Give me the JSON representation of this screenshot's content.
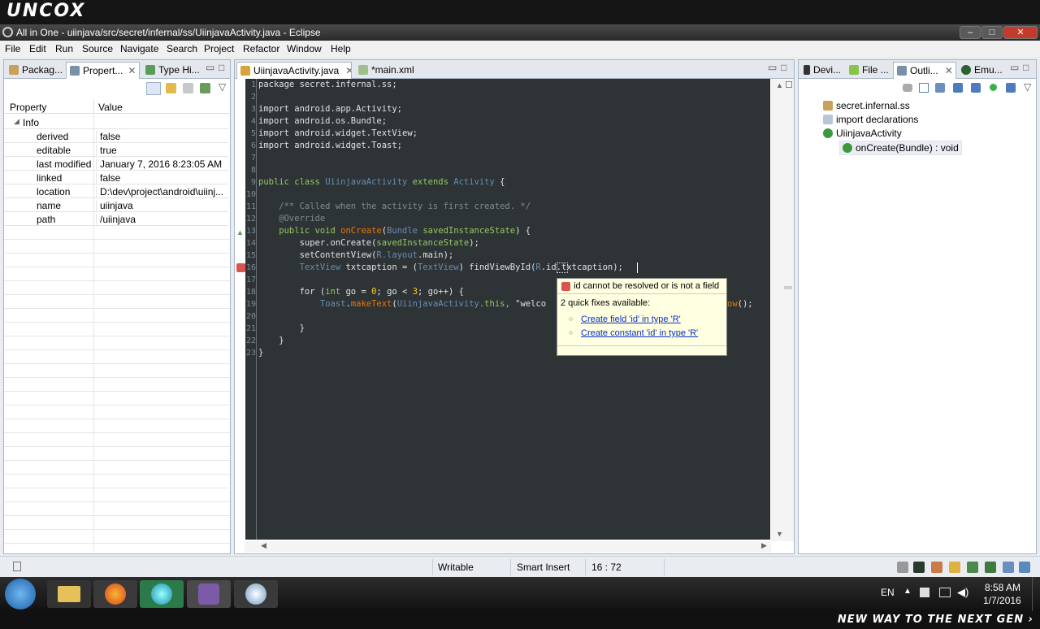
{
  "banner": {
    "brand": "UNCOX",
    "tagline": "NEW WAY TO THE NEXT GEN ›"
  },
  "window": {
    "title": "All in One - uiinjava/src/secret/infernal/ss/UiinjavaActivity.java - Eclipse",
    "minimize": "‒",
    "maximize": "□",
    "close": "✕"
  },
  "menu": [
    "File",
    "Edit",
    "Run",
    "Source",
    "Navigate",
    "Search",
    "Project",
    "Refactor",
    "Window",
    "Help"
  ],
  "left_tabs": [
    "Packag...",
    "Propert...",
    "Type Hi..."
  ],
  "properties": {
    "headers": {
      "property": "Property",
      "value": "Value"
    },
    "group": "Info",
    "rows": [
      {
        "k": "derived",
        "v": "false"
      },
      {
        "k": "editable",
        "v": "true"
      },
      {
        "k": "last modified",
        "v": "January 7, 2016 8:23:05 AM"
      },
      {
        "k": "linked",
        "v": "false"
      },
      {
        "k": "location",
        "v": "D:\\dev\\project\\android\\uiinj..."
      },
      {
        "k": "name",
        "v": "uiinjava"
      },
      {
        "k": "path",
        "v": "/uiinjava"
      }
    ]
  },
  "editor_tabs": [
    "UiinjavaActivity.java",
    "*main.xml"
  ],
  "code": {
    "line_numbers": [
      "1",
      "2",
      "3",
      "4",
      "5",
      "6",
      "7",
      "8",
      "9",
      "10",
      "11",
      "12",
      "13",
      "14",
      "15",
      "16",
      "17",
      "18",
      "19",
      "20",
      "21",
      "22",
      "23"
    ],
    "l1": "package secret.infernal.ss;",
    "l3": "import android.app.Activity;",
    "l4": "import android.os.Bundle;",
    "l5": "import android.widget.TextView;",
    "l6": "import android.widget.Toast;",
    "l9a": "public class ",
    "l9b": "UiinjavaActivity",
    "l9c": " extends ",
    "l9d": "Activity",
    "l9e": " {",
    "l11": "    /** Called when the activity is first created. */",
    "l12": "    @Override",
    "l13a": "    public void ",
    "l13b": "onCreate",
    "l13c": "(",
    "l13d": "Bundle",
    "l13e": " savedInstanceState",
    "l13f": ") {",
    "l14a": "        super.onCreate(",
    "l14b": "savedInstanceState",
    "l14c": ");",
    "l15a": "        setContentView(",
    "l15b": "R",
    "l15c": ".layout",
    "l15d": ".main);",
    "l16a": "        ",
    "l16b": "TextView",
    "l16c": " txtcaption = (",
    "l16d": "TextView",
    "l16e": ") findViewById(",
    "l16f": "R",
    "l16g": ".id.txtcaption);",
    "l18a": "        for (",
    "l18b": "int",
    "l18c": " go = ",
    "l18d": "0",
    "l18e": "; go < ",
    "l18f": "3",
    "l18g": "; go++) {",
    "l19a": "            ",
    "l19b": "Toast",
    "l19c": ".",
    "l19d": "makeText",
    "l19e": "(",
    "l19f": "UiinjavaActivity",
    "l19g": ".this, ",
    "l19h": "\"welco",
    "l19i": "ow",
    "l19j": "();",
    "l21": "        }",
    "l22": "    }",
    "l23": "}"
  },
  "quickfix": {
    "error": "id cannot be resolved or is not a field",
    "available": "2 quick fixes available:",
    "fixes": [
      "Create field 'id' in type 'R'",
      "Create constant 'id' in type 'R'"
    ]
  },
  "right_tabs": [
    "Devi...",
    "File ...",
    "Outli...",
    "Emu..."
  ],
  "outline": {
    "items": [
      "secret.infernal.ss",
      "import declarations",
      "UiinjavaActivity",
      "onCreate(Bundle) : void"
    ]
  },
  "status": {
    "writable": "Writable",
    "insert": "Smart Insert",
    "position": "16 : 72"
  },
  "taskbar": {
    "lang": "EN",
    "time": "8:58 AM",
    "date": "1/7/2016"
  },
  "colors": {
    "editor_bg": "#2e3436",
    "keyword": "#93c763",
    "type": "#678cb1",
    "method": "#ec7600",
    "comment": "#7d8c93",
    "link": "#0a2ec7"
  }
}
